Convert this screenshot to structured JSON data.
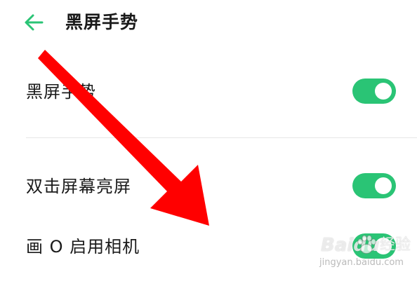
{
  "header": {
    "back_icon": "arrow-left-icon",
    "title": "黑屏手势"
  },
  "settings": {
    "items": [
      {
        "label": "黑屏手势",
        "toggle_on": true
      },
      {
        "label": "双击屏幕亮屏",
        "toggle_on": true
      },
      {
        "label": "画 O 启用相机",
        "toggle_on": true
      }
    ]
  },
  "colors": {
    "accent_green": "#2ac475",
    "annotation_arrow": "#ff0000"
  },
  "watermark": {
    "logo_text": "Baidu",
    "brand_text": "经验",
    "url_text": "jingyan.baidu.com"
  }
}
